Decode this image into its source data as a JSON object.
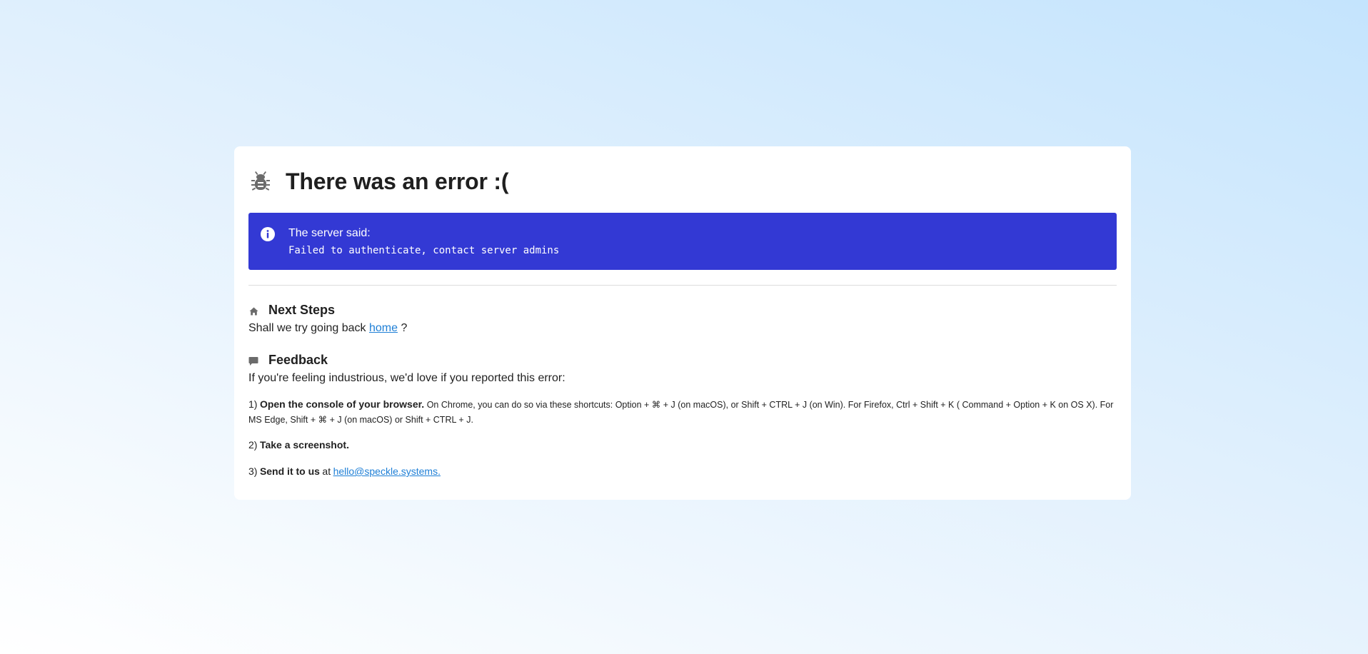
{
  "error": {
    "title": "There was an error :(",
    "icon": "bug-icon"
  },
  "alert": {
    "icon": "info-icon",
    "label": "The server said:",
    "message": "Failed to authenticate, contact server admins",
    "color": "#3339d4"
  },
  "next_steps": {
    "icon": "home-icon",
    "title": "Next Steps",
    "text_before": "Shall we try going back",
    "link_text": "home",
    "text_after": "?"
  },
  "feedback": {
    "icon": "comment-icon",
    "title": "Feedback",
    "intro": "If you're feeling industrious, we'd love if you reported this error:",
    "steps": [
      {
        "num": "1)",
        "bold": "Open the console of your browser.",
        "detail": "On Chrome, you can do so via these shortcuts: Option + ⌘ + J (on macOS), or Shift + CTRL + J (on Win). For Firefox, Ctrl + Shift + K ( Command + Option + K on OS X). For MS Edge, Shift + ⌘ + J (on macOS) or Shift + CTRL + J."
      },
      {
        "num": "2)",
        "bold": "Take a screenshot."
      },
      {
        "num": "3)",
        "bold": "Send it to us",
        "at": "at",
        "email": "hello@speckle.systems."
      }
    ]
  },
  "colors": {
    "link": "#1e7fd6",
    "icon_gray": "#6b6b6b"
  }
}
